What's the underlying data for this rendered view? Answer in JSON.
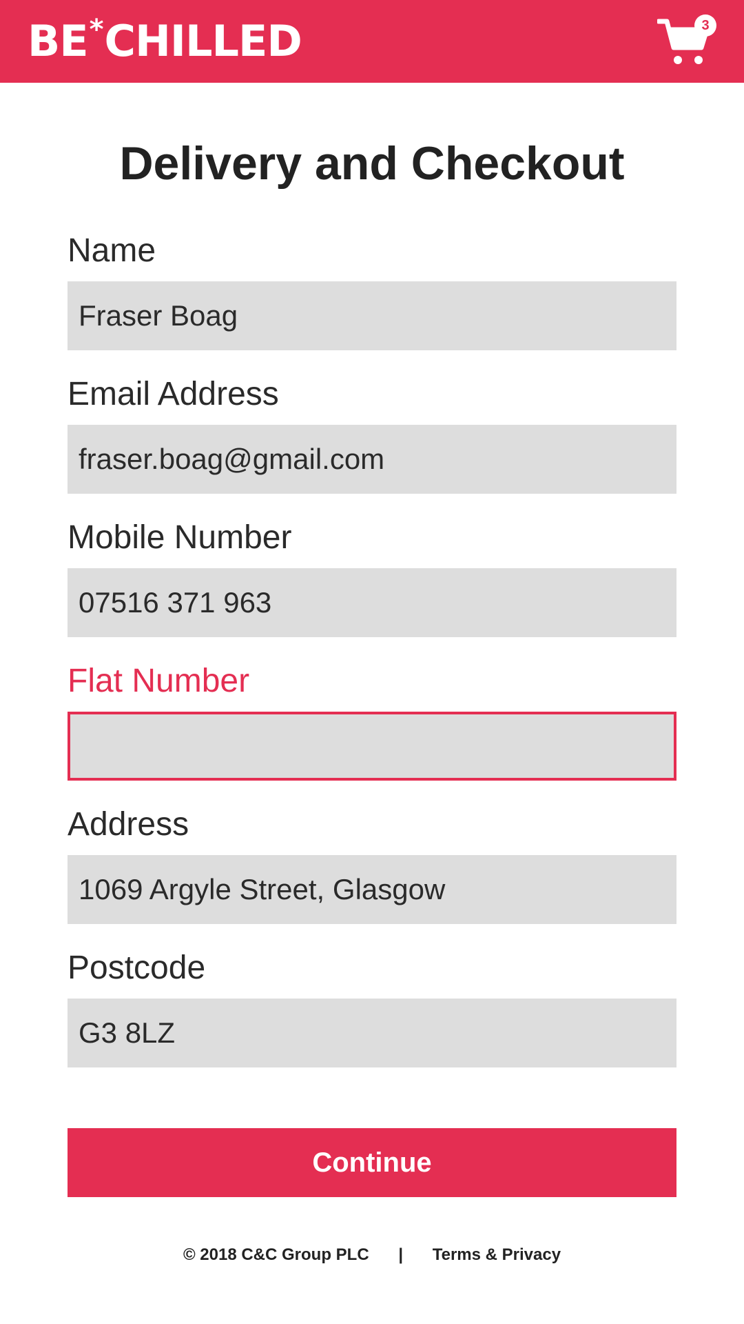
{
  "header": {
    "logo_left": "BE",
    "logo_star": "*",
    "logo_right": "CHILLED",
    "cart_count": "3",
    "cart_icon": "shopping-cart-icon",
    "brand_color": "#e42e52"
  },
  "page": {
    "title": "Delivery and Checkout"
  },
  "form": {
    "name": {
      "label": "Name",
      "value": "Fraser Boag"
    },
    "email": {
      "label": "Email Address",
      "value": "fraser.boag@gmail.com"
    },
    "mobile": {
      "label": "Mobile Number",
      "value": "07516 371 963"
    },
    "flat": {
      "label": "Flat Number",
      "value": "",
      "state": "error"
    },
    "address": {
      "label": "Address",
      "value": "1069 Argyle Street, Glasgow"
    },
    "postcode": {
      "label": "Postcode",
      "value": "G3 8LZ"
    }
  },
  "actions": {
    "continue_label": "Continue"
  },
  "footer": {
    "copyright": "© 2018 C&C Group PLC",
    "separator": "|",
    "terms_link": "Terms & Privacy"
  }
}
